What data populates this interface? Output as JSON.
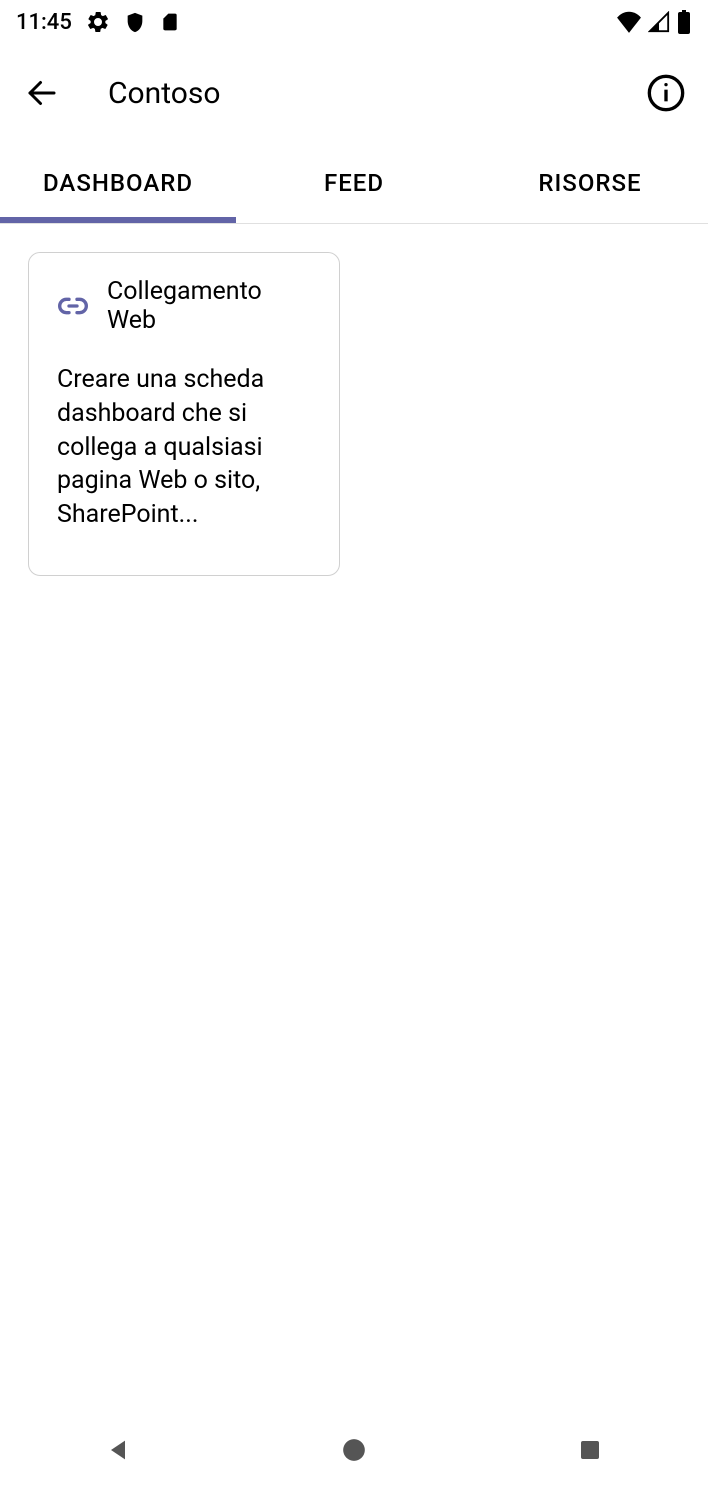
{
  "status_bar": {
    "time": "11:45"
  },
  "header": {
    "title": "Contoso"
  },
  "tabs": [
    {
      "label": "DASHBOARD",
      "active": true
    },
    {
      "label": "FEED",
      "active": false
    },
    {
      "label": "RISORSE",
      "active": false
    }
  ],
  "card": {
    "title": "Collegamento Web",
    "description": "Creare una scheda dashboard che si collega a qualsiasi pagina Web o sito, SharePoint..."
  }
}
